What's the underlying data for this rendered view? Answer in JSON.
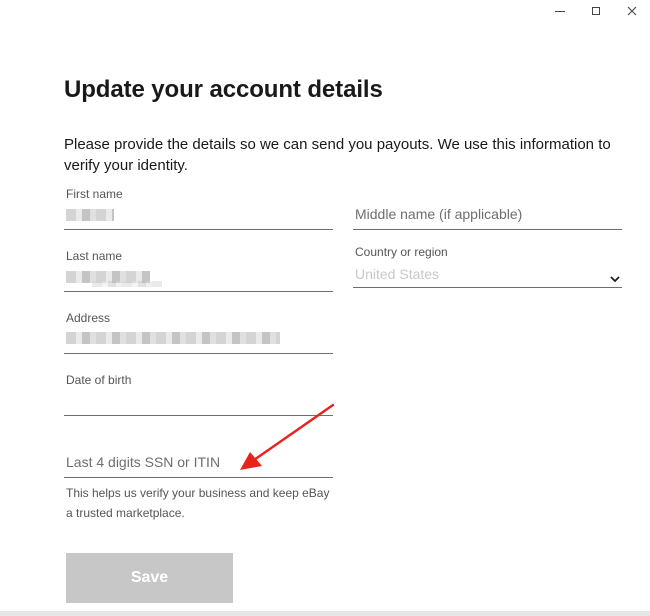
{
  "page": {
    "title": "Update your account details",
    "intro": "Please provide the details so we can send you payouts. We use this information to verify your identity."
  },
  "form": {
    "first_name": {
      "label": "First name"
    },
    "middle_name": {
      "placeholder": "Middle name (if applicable)"
    },
    "last_name": {
      "label": "Last name"
    },
    "country": {
      "label": "Country or region",
      "value": "United States"
    },
    "address": {
      "label": "Address"
    },
    "dob": {
      "label": "Date of birth"
    },
    "ssn": {
      "placeholder": "Last 4 digits SSN or ITIN",
      "helper": "This helps us verify your business and keep eBay a trusted marketplace."
    },
    "save_label": "Save"
  },
  "icons": {
    "minimize": "minimize-icon",
    "maximize": "maximize-icon",
    "close": "close-icon",
    "chevron": "chevron-down-icon",
    "annotation": "red-arrow-annotation"
  },
  "colors": {
    "disabled_button": "#c7c7c7",
    "annotation_arrow": "#e8231e"
  }
}
